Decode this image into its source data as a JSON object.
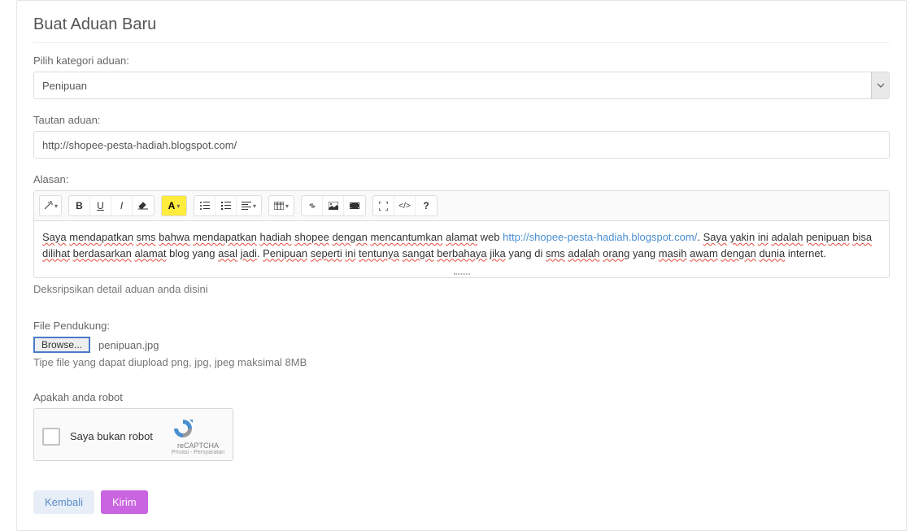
{
  "title": "Buat Aduan Baru",
  "category": {
    "label": "Pilih kategori aduan:",
    "value": "Penipuan"
  },
  "link": {
    "label": "Tautan aduan:",
    "value": "http://shopee-pesta-hadiah.blogspot.com/"
  },
  "reason": {
    "label": "Alasan:",
    "helper": "Deksripsikan detail aduan anda disini",
    "text_parts": {
      "p1": "Saya",
      "p2": "mendapatkan",
      "p3": "sms",
      "p4": "bahwa",
      "p5": "mendapatkan",
      "p6": "hadiah",
      "p7": "shopee",
      "p8": "dengan",
      "p9": "mencantumkan",
      "p10": "alamat",
      "p11": "web",
      "link": "http://shopee-pesta-hadiah.blogspot.com/",
      "p12": ". ",
      "p13": "Saya",
      "p14": "yakin",
      "p15": "ini",
      "p16": "adalah",
      "p17": "penipuan",
      "p18": "bisa",
      "p19": "dilihat",
      "p20": "berdasarkan",
      "p21": "alamat",
      "p22": "blog yang",
      "p23": "asal",
      "p24": "jadi",
      "p25": ". ",
      "p26": "Penipuan",
      "p27": "seperti",
      "p28": "ini",
      "p29": "tentunya",
      "p30": "sangat",
      "p31": "berbahaya",
      "p32": "jika",
      "p33": "yang di",
      "p34": "sms",
      "p35": "adalah",
      "p36": "orang",
      "p37": "yang",
      "p38": "masih",
      "p39": "awam",
      "p40": "dengan",
      "p41": "dunia",
      "p42": "internet."
    }
  },
  "file": {
    "label": "File Pendukung:",
    "button": "Browse...",
    "name": "penipuan.jpg",
    "helper": "Tipe file yang dapat diupload png, jpg, jpeg maksimal 8MB"
  },
  "captcha": {
    "label": "Apakah anda robot",
    "checkbox_label": "Saya bukan robot",
    "brand": "reCAPTCHA",
    "privacy": "Privasi - Persyaratan"
  },
  "buttons": {
    "back": "Kembali",
    "send": "Kirim"
  },
  "icons": {
    "bold": "B",
    "underline": "U",
    "italic": "I",
    "question": "?"
  }
}
